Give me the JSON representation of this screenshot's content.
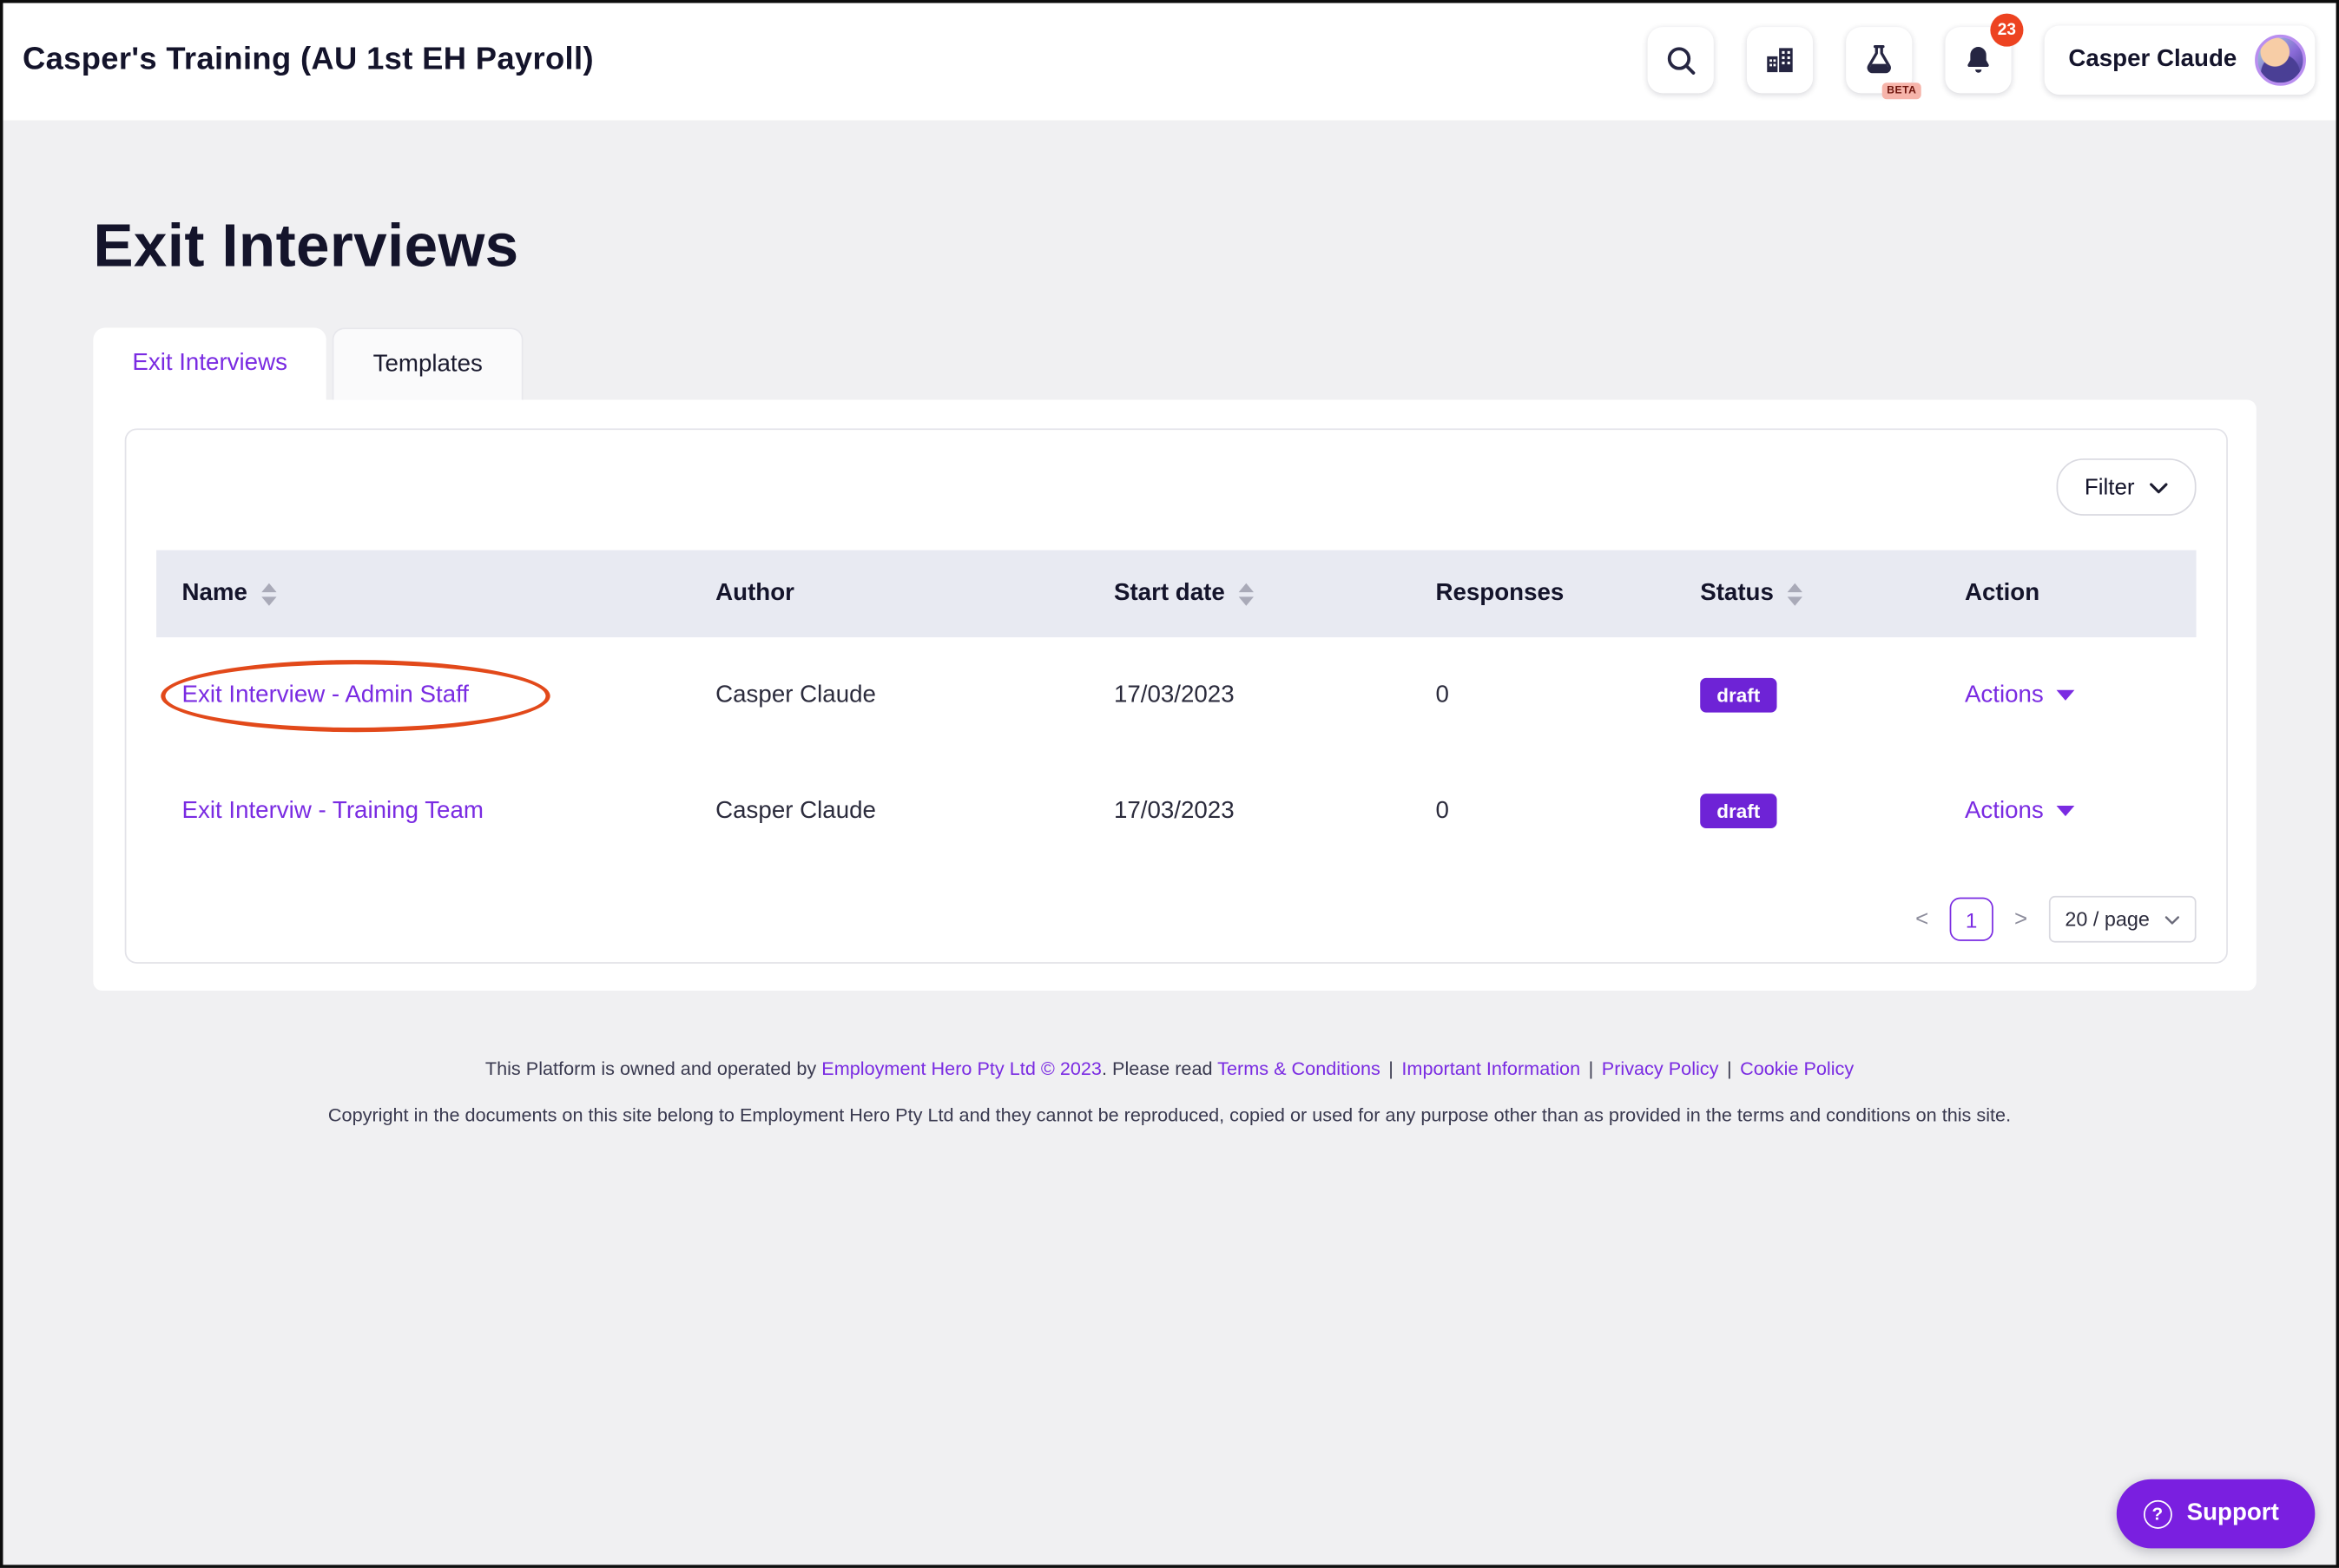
{
  "header": {
    "workspace_title": "Casper's Training (AU 1st EH Payroll)",
    "user_name": "Casper Claude",
    "notification_count": "23",
    "beta_label": "BETA"
  },
  "page": {
    "title": "Exit Interviews"
  },
  "tabs": {
    "exit_interviews": "Exit Interviews",
    "templates": "Templates"
  },
  "toolbar": {
    "filter_label": "Filter"
  },
  "table": {
    "columns": [
      {
        "label": "Name",
        "sortable": true
      },
      {
        "label": "Author",
        "sortable": false
      },
      {
        "label": "Start date",
        "sortable": true
      },
      {
        "label": "Responses",
        "sortable": false
      },
      {
        "label": "Status",
        "sortable": true
      },
      {
        "label": "Action",
        "sortable": false
      }
    ],
    "rows": [
      {
        "name": "Exit Interview - Admin Staff",
        "author": "Casper Claude",
        "start_date": "17/03/2023",
        "responses": "0",
        "status": "draft",
        "action_label": "Actions",
        "annotated": true
      },
      {
        "name": "Exit Interviw - Training Team",
        "author": "Casper Claude",
        "start_date": "17/03/2023",
        "responses": "0",
        "status": "draft",
        "action_label": "Actions",
        "annotated": false
      }
    ]
  },
  "pagination": {
    "prev": "<",
    "current_page": "1",
    "next": ">",
    "page_size": "20 / page"
  },
  "footer": {
    "line1_prefix": "This Platform is owned and operated by",
    "line1_link_company": "Employment Hero Pty Ltd © 2023",
    "line1_mid": ". Please read",
    "separator": "|",
    "links": {
      "terms": "Terms & Conditions",
      "important": "Important Information",
      "privacy": "Privacy Policy",
      "cookie": "Cookie Policy"
    },
    "line2": "Copyright in the documents on this site belong to Employment Hero Pty Ltd and they cannot be reproduced, copied or used for any purpose other than as provided in the terms and conditions on this site."
  },
  "support": {
    "label": "Support"
  },
  "icons": {
    "question_mark": "?"
  },
  "colors": {
    "primary_purple": "#7a2be2",
    "badge_purple": "#6e23d6",
    "annotation_orange": "#e2491a",
    "notification_red": "#ed4321",
    "table_header_bg": "#e8eaf2",
    "page_bg": "#f0f0f2"
  }
}
